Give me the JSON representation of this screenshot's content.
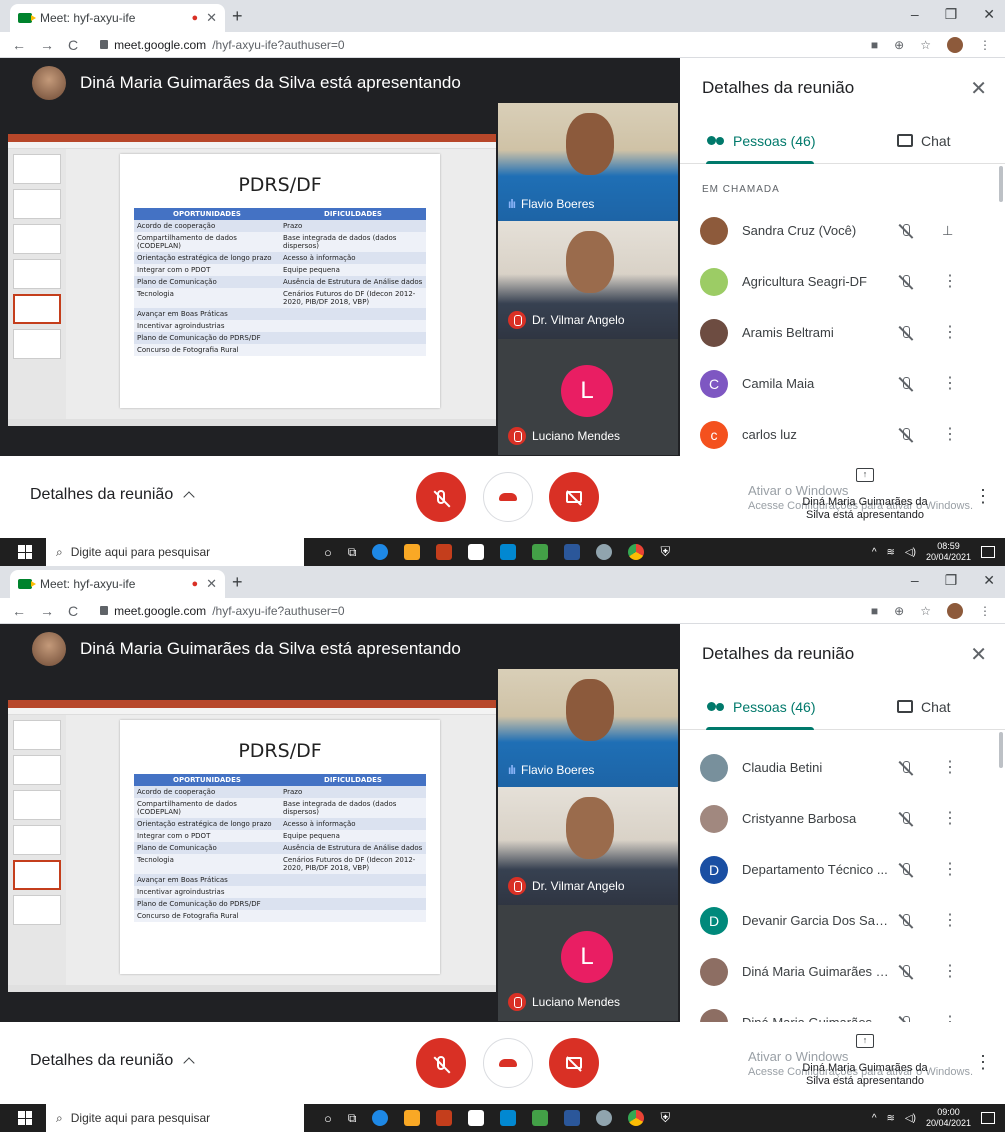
{
  "colors": {
    "meet_green": "#00796b",
    "danger_red": "#d93025",
    "avatar_pink": "#e91e63"
  },
  "screens": [
    {
      "tab_title": "Meet: hyf-axyu-ife",
      "url_host": "meet.google.com",
      "url_path": "/hyf-axyu-ife?authuser=0",
      "presenter_text": "Diná Maria Guimarães da Silva está apresentando",
      "slide_title": "PDRS/DF",
      "table_headers": [
        "OPORTUNIDADES",
        "DIFICULDADES"
      ],
      "table_rows": [
        [
          "Acordo de cooperação",
          "Prazo"
        ],
        [
          "Compartilhamento de dados (CODEPLAN)",
          "Base integrada de dados (dados dispersos)"
        ],
        [
          "Orientação estratégica de longo prazo",
          "Acesso à informação"
        ],
        [
          "Integrar com o PDOT",
          "Equipe pequena"
        ],
        [
          "Plano de Comunicação",
          "Ausência de Estrutura de Análise dados"
        ],
        [
          "Tecnologia",
          "Cenários Futuros do DF (Idecon 2012-2020, PIB/DF 2018, VBP)"
        ],
        [
          "Avançar em Boas Práticas",
          ""
        ],
        [
          "Incentivar agroindustrias",
          ""
        ],
        [
          "Plano de Comunicação do PDRS/DF",
          ""
        ],
        [
          "Concurso de Fotografia Rural",
          ""
        ]
      ],
      "tiles": [
        "Flavio Boeres",
        "Dr. Vilmar Angelo",
        "Luciano Mendes"
      ],
      "tile_letter": "L",
      "panel_title": "Detalhes da reunião",
      "people_tab": "Pessoas (46)",
      "chat_tab": "Chat",
      "section_label": "EM CHAMADA",
      "people": [
        {
          "name": "Sandra Cruz (Você)",
          "initial": "",
          "color": "#8d5a3b",
          "action": "pin"
        },
        {
          "name": "Agricultura Seagri-DF",
          "initial": "",
          "color": "#9ccc65",
          "action": "more"
        },
        {
          "name": "Aramis Beltrami",
          "initial": "",
          "color": "#6d4c41",
          "action": "more"
        },
        {
          "name": "Camila Maia",
          "initial": "C",
          "color": "#7e57c2",
          "action": "more"
        },
        {
          "name": "carlos luz",
          "initial": "c",
          "color": "#f4511e",
          "action": "more"
        }
      ],
      "details_label": "Detalhes da reunião",
      "presenting_text": "Diná Maria Guimarães da Silva está apresentando",
      "watermark_title": "Ativar o Windows",
      "watermark_sub": "Acesse Configurações para ativar o Windows.",
      "search_placeholder": "Digite aqui para pesquisar",
      "time": "08:59",
      "date": "20/04/2021"
    },
    {
      "tab_title": "Meet: hyf-axyu-ife",
      "url_host": "meet.google.com",
      "url_path": "/hyf-axyu-ife?authuser=0",
      "presenter_text": "Diná Maria Guimarães da Silva está apresentando",
      "slide_title": "PDRS/DF",
      "table_headers": [
        "OPORTUNIDADES",
        "DIFICULDADES"
      ],
      "table_rows": [
        [
          "Acordo de cooperação",
          "Prazo"
        ],
        [
          "Compartilhamento de dados (CODEPLAN)",
          "Base integrada de dados (dados dispersos)"
        ],
        [
          "Orientação estratégica de longo prazo",
          "Acesso à informação"
        ],
        [
          "Integrar com o PDOT",
          "Equipe pequena"
        ],
        [
          "Plano de Comunicação",
          "Ausência de Estrutura de Análise dados"
        ],
        [
          "Tecnologia",
          "Cenários Futuros do DF (Idecon 2012-2020, PIB/DF 2018, VBP)"
        ],
        [
          "Avançar em Boas Práticas",
          ""
        ],
        [
          "Incentivar agroindustrias",
          ""
        ],
        [
          "Plano de Comunicação do PDRS/DF",
          ""
        ],
        [
          "Concurso de Fotografia Rural",
          ""
        ]
      ],
      "tiles": [
        "Flavio Boeres",
        "Dr. Vilmar Angelo",
        "Luciano Mendes"
      ],
      "tile_letter": "L",
      "panel_title": "Detalhes da reunião",
      "people_tab": "Pessoas (46)",
      "chat_tab": "Chat",
      "section_label": "",
      "people": [
        {
          "name": "Claudia Betini",
          "initial": "",
          "color": "#78909c",
          "action": "more"
        },
        {
          "name": "Cristyanne Barbosa",
          "initial": "",
          "color": "#a1887f",
          "action": "more"
        },
        {
          "name": "Departamento Técnico ...",
          "initial": "D",
          "color": "#1a4fa3",
          "action": "more"
        },
        {
          "name": "Devanir Garcia Dos San...",
          "initial": "D",
          "color": "#00897b",
          "action": "more"
        },
        {
          "name": "Diná Maria Guimarães d...",
          "initial": "",
          "color": "#8d6e63",
          "action": "more"
        },
        {
          "name": "Diná Maria Guimarães d...",
          "initial": "",
          "color": "#8d6e63",
          "action": "more"
        }
      ],
      "details_label": "Detalhes da reunião",
      "presenting_text": "Diná Maria Guimarães da Silva está apresentando",
      "watermark_title": "Ativar o Windows",
      "watermark_sub": "Acesse Configurações para ativar o Windows.",
      "search_placeholder": "Digite aqui para pesquisar",
      "time": "09:00",
      "date": "20/04/2021"
    }
  ]
}
